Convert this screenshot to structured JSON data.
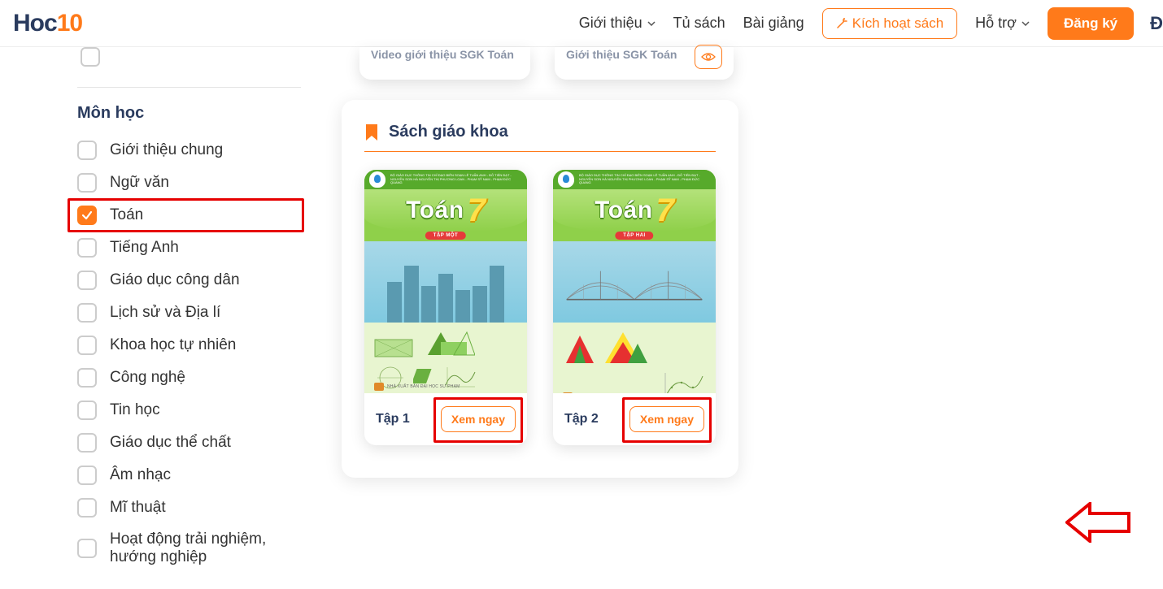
{
  "header": {
    "logo_prefix": "Hoc",
    "logo_suffix": "10",
    "nav": {
      "intro": "Giới thiệu",
      "bookshelf": "Tủ sách",
      "lecture": "Bài giảng",
      "activate": "Kích hoạt sách",
      "support": "Hỗ trợ",
      "register": "Đăng ký",
      "cutoff": "Đ"
    }
  },
  "sidebar": {
    "subject_title": "Môn học",
    "subjects": [
      {
        "label": "Giới thiệu chung",
        "checked": false
      },
      {
        "label": "Ngữ văn",
        "checked": false
      },
      {
        "label": "Toán",
        "checked": true,
        "highlight": true
      },
      {
        "label": "Tiếng Anh",
        "checked": false
      },
      {
        "label": "Giáo dục công dân",
        "checked": false
      },
      {
        "label": "Lịch sử và Địa lí",
        "checked": false
      },
      {
        "label": "Khoa học tự nhiên",
        "checked": false
      },
      {
        "label": "Công nghệ",
        "checked": false
      },
      {
        "label": "Tin học",
        "checked": false
      },
      {
        "label": "Giáo dục thể chất",
        "checked": false
      },
      {
        "label": "Âm nhạc",
        "checked": false
      },
      {
        "label": "Mĩ thuật",
        "checked": false
      },
      {
        "label": "Hoạt động trải nghiệm, hướng nghiệp",
        "checked": false
      }
    ]
  },
  "main": {
    "mini1": "Video giới thiệu SGK Toán",
    "mini2": "Giới thiệu SGK Toán",
    "panel_title": "Sách giáo khoa",
    "book_title": "Toán",
    "book_num": "7",
    "vol1": "TẬP MỘT",
    "vol2": "TẬP HAI",
    "publisher": "NHÀ XUẤT BẢN ĐẠI HỌC SƯ PHẠM",
    "credit": "BỘ GIÁO DỤC THÔNG TIN CHỈ ĐẠO BIÊN SOẠN\nLÊ TUẤN ANH - ĐỖ TIẾN ĐẠT - NGUYỄN SƠN HÀ\nNGUYỄN THỊ PHƯƠNG LOAN - PHẠM SỸ NAM - PHẠM ĐỨC QUANG",
    "foot1": "Tập 1",
    "foot2": "Tập 2",
    "view": "Xem ngay"
  }
}
